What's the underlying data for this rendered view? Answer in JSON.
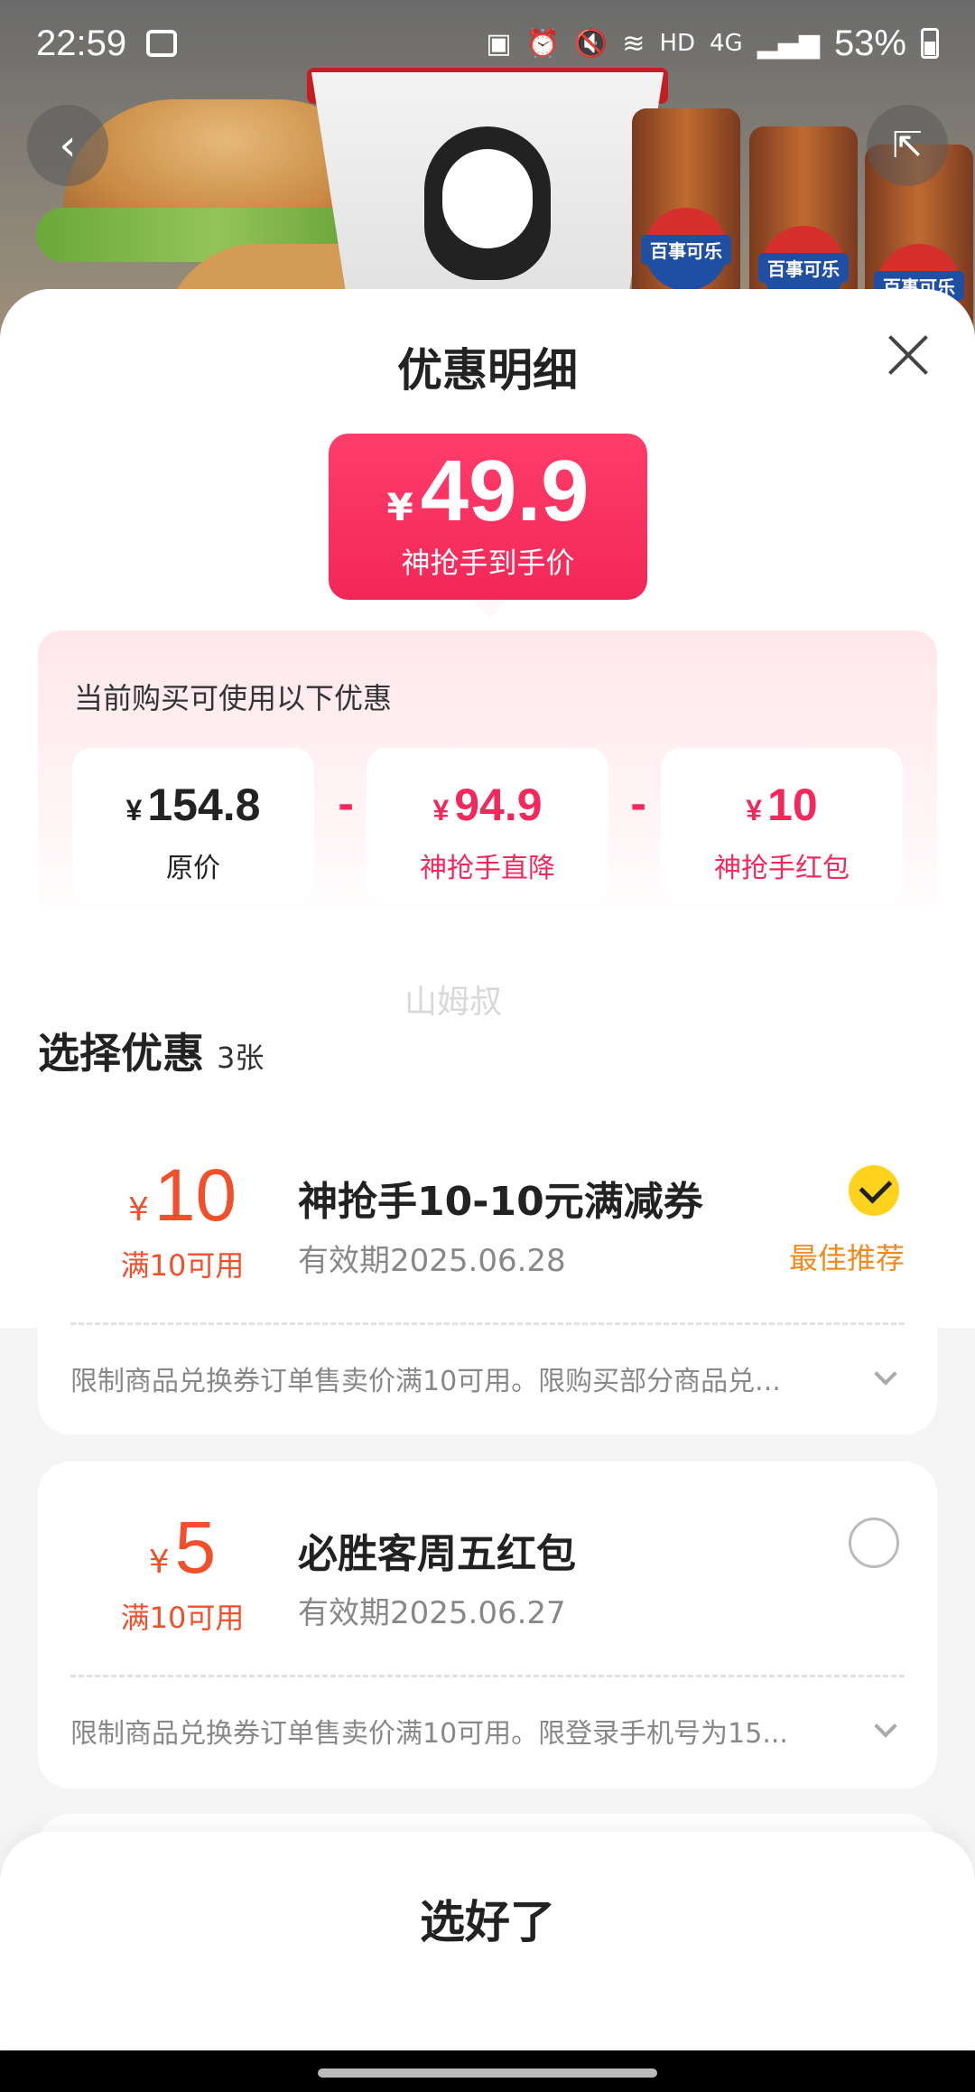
{
  "status_bar": {
    "time": "22:59",
    "network": "HD",
    "signal": "4G",
    "battery": "53%"
  },
  "hero": {
    "can_label": "百事可乐"
  },
  "sheet": {
    "title": "优惠明细",
    "final_price": {
      "currency": "¥",
      "value": "49.9",
      "label": "神抢手到手价"
    },
    "breakdown": {
      "title": "当前购买可使用以下优惠",
      "items": [
        {
          "currency": "¥",
          "value": "154.8",
          "label": "原价"
        },
        {
          "currency": "¥",
          "value": "94.9",
          "label": "神抢手直降"
        },
        {
          "currency": "¥",
          "value": "10",
          "label": "神抢手红包"
        }
      ],
      "minus": "-"
    },
    "watermark": "山姆叔",
    "select_section": {
      "title": "选择优惠",
      "count": "3张"
    },
    "coupons": [
      {
        "currency": "¥",
        "amount": "10",
        "condition": "满10可用",
        "name": "神抢手10-10元满减券",
        "validity": "有效期2025.06.28",
        "selected": true,
        "tag": "最佳推荐",
        "description": "限制商品兑换券订单售卖价满10可用。限购买部分商品兑..."
      },
      {
        "currency": "¥",
        "amount": "5",
        "condition": "满10可用",
        "name": "必胜客周五红包",
        "validity": "有效期2025.06.27",
        "selected": false,
        "tag": "",
        "description": "限制商品兑换券订单售卖价满10可用。限登录手机号为15..."
      }
    ],
    "confirm_label": "选好了"
  },
  "colors": {
    "accent_pink": "#f2295d",
    "coupon_orange": "#f0502a",
    "best_tag_orange": "#f08a1e",
    "check_yellow": "#ffd21e"
  }
}
